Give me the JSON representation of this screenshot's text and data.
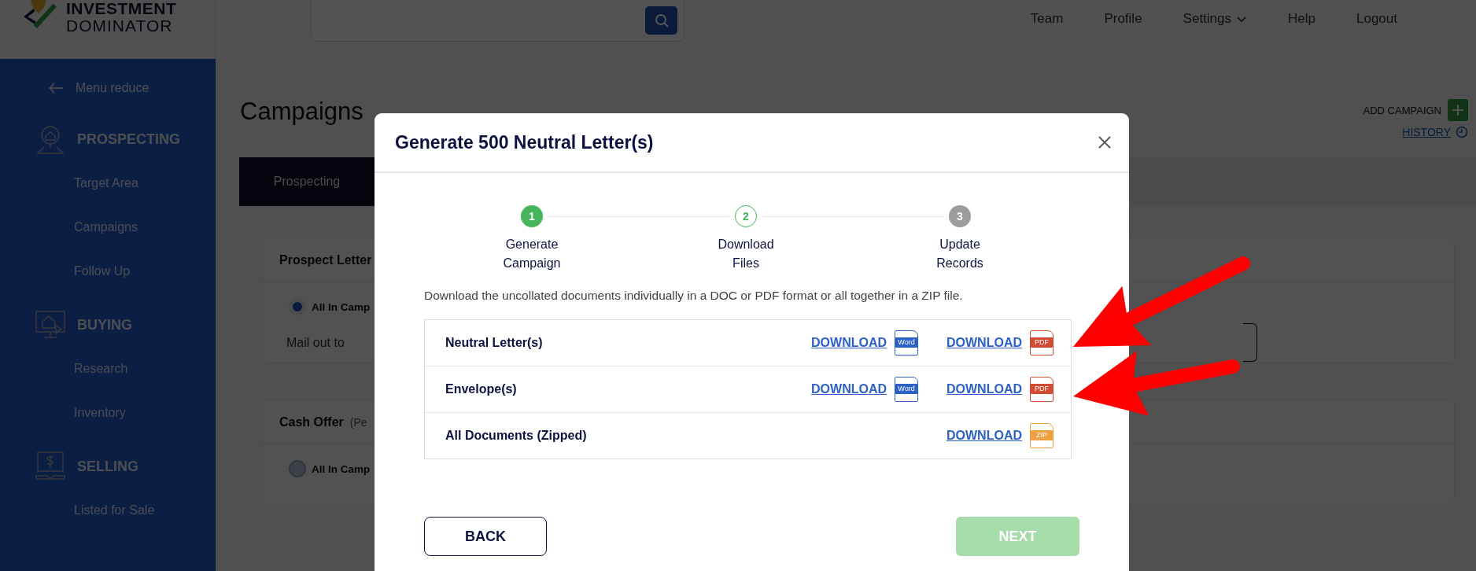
{
  "header": {
    "logo": {
      "line1": "INVESTMENT",
      "line2": "DOMINATOR"
    },
    "nav": [
      {
        "label": "Team",
        "has_menu": false
      },
      {
        "label": "Profile",
        "has_menu": false
      },
      {
        "label": "Settings",
        "has_menu": true
      },
      {
        "label": "Help",
        "has_menu": false
      },
      {
        "label": "Logout",
        "has_menu": false
      }
    ]
  },
  "sidebar": {
    "collapse_label": "Menu reduce",
    "sections": [
      {
        "title": "PROSPECTING",
        "items": [
          "Target Area",
          "Campaigns",
          "Follow Up"
        ]
      },
      {
        "title": "BUYING",
        "items": [
          "Research",
          "Inventory"
        ]
      },
      {
        "title": "SELLING",
        "items": [
          "Listed for Sale"
        ]
      }
    ]
  },
  "page": {
    "title": "Campaigns",
    "add_label": "ADD CAMPAIGN",
    "history_label": "HISTORY",
    "tabs": [
      {
        "label": "Prospecting",
        "selected": true
      }
    ],
    "cards": [
      {
        "title": "Prospect Letter",
        "option": {
          "label": "All In Camp",
          "selected": true
        },
        "mail_label": "Mail out to",
        "has_button": true
      },
      {
        "title": "Cash Offer",
        "subtitle": "(Pe",
        "option": {
          "label": "All In Camp",
          "selected": false
        }
      }
    ]
  },
  "modal": {
    "title": "Generate 500 Neutral Letter(s)",
    "steps": [
      {
        "number": "1",
        "label": "Generate Campaign",
        "completed": true,
        "current": false
      },
      {
        "number": "2",
        "label": "Download Files",
        "completed": false,
        "current": true
      },
      {
        "number": "3",
        "label": "Update Records",
        "completed": false,
        "current": false
      }
    ],
    "description": "Download the uncollated documents individually in a DOC or PDF format or all together in a ZIP file.",
    "files": [
      {
        "label": "Neutral Letter(s)",
        "downloads": [
          {
            "label": "DOWNLOAD",
            "kind": "word",
            "icon_text": "Word"
          },
          {
            "label": "DOWNLOAD",
            "kind": "pdf",
            "icon_text": "PDF"
          }
        ]
      },
      {
        "label": "Envelope(s)",
        "downloads": [
          {
            "label": "DOWNLOAD",
            "kind": "word",
            "icon_text": "Word"
          },
          {
            "label": "DOWNLOAD",
            "kind": "pdf",
            "icon_text": "PDF"
          }
        ]
      },
      {
        "label": "All Documents (Zipped)",
        "downloads": [
          {
            "label": "DOWNLOAD",
            "kind": "zip",
            "icon_text": "ZIP"
          }
        ]
      }
    ],
    "back": "BACK",
    "next": {
      "label": "NEXT",
      "disabled": true
    }
  }
}
